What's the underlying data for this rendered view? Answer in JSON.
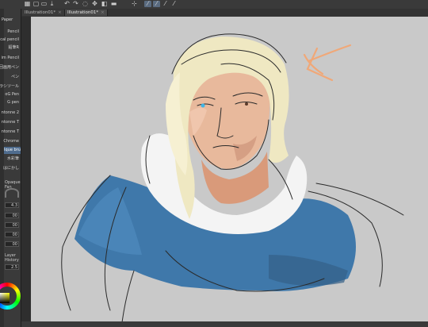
{
  "toolbar": {
    "icons": [
      "grid-icon",
      "new-icon",
      "open-icon",
      "save-icon",
      "undo-icon",
      "redo-icon",
      "lasso-icon",
      "transform-icon",
      "fill-icon",
      "ruler-icon",
      "snap-icon",
      "snap-grid-icon",
      "snap-special-icon"
    ]
  },
  "tabs": [
    {
      "label": "Illustration01*",
      "active": false
    },
    {
      "label": "Illustration01*",
      "active": true
    }
  ],
  "left_panel": {
    "header": "Paper",
    "brushes": [
      "Pencil",
      "ical pencil",
      "鉛筆R",
      "im Pencil",
      "回画用ペン",
      "ペン",
      "ラシツール",
      "oG Pen",
      "G pen",
      "ntonne 2",
      "ntonne T",
      "ntonne T",
      "Chrome",
      "Ique brush",
      "水彩筆",
      "はにかし"
    ],
    "selected_brush": "Ique brush",
    "section_label": "Opaque Fan",
    "values": [
      "4.3",
      "00",
      "00",
      "00",
      "00",
      "2.5"
    ],
    "sublabel": "Layer History"
  },
  "colors": {
    "canvas_bg": "#c9c9c9",
    "hair": "#efe8c2",
    "skin": "#e8b99c",
    "coat": "#3f78aa",
    "fur": "#f4f4f4",
    "arrow": "#f0a878",
    "selected": "#4f6c8e"
  }
}
